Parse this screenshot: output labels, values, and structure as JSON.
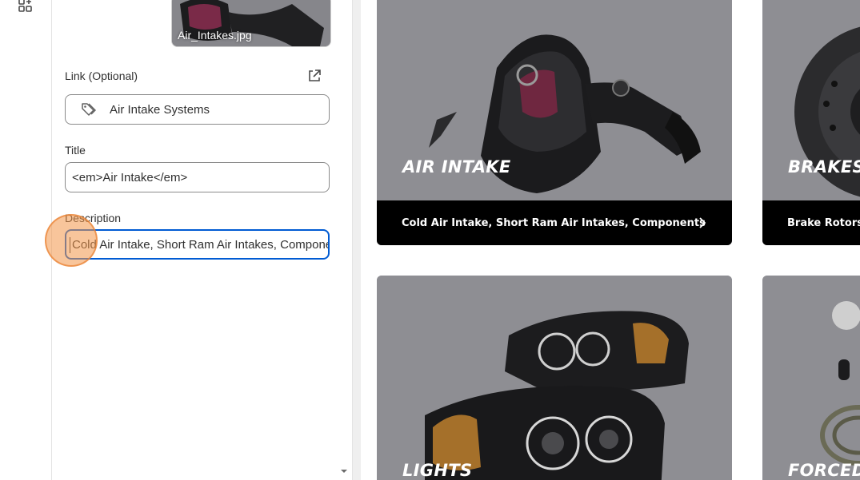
{
  "thumbnail": {
    "filename": "Air_Intakes.jpg"
  },
  "link": {
    "label": "Link (Optional)",
    "value": "Air Intake Systems"
  },
  "title_field": {
    "label": "Title",
    "value": "<em>Air Intake</em>"
  },
  "description_field": {
    "label": "Description",
    "value": "Cold Air Intake, Short Ram Air Intakes, Components"
  },
  "cards": [
    {
      "title": "AIR INTAKE",
      "subtitle": "Cold Air Intake, Short Ram Air Intakes, Components"
    },
    {
      "title": "BRAKES",
      "subtitle": "Brake Rotors, P"
    },
    {
      "title": "LIGHTS"
    },
    {
      "title": "FORCED I"
    }
  ],
  "colors": {
    "focus": "#005bd3",
    "card_gray": "#8e8e93",
    "bar": "#000000"
  },
  "icons": [
    "apps-icon",
    "external-link-icon",
    "tag-icon",
    "chevron-right-icon",
    "chevron-down-icon"
  ]
}
